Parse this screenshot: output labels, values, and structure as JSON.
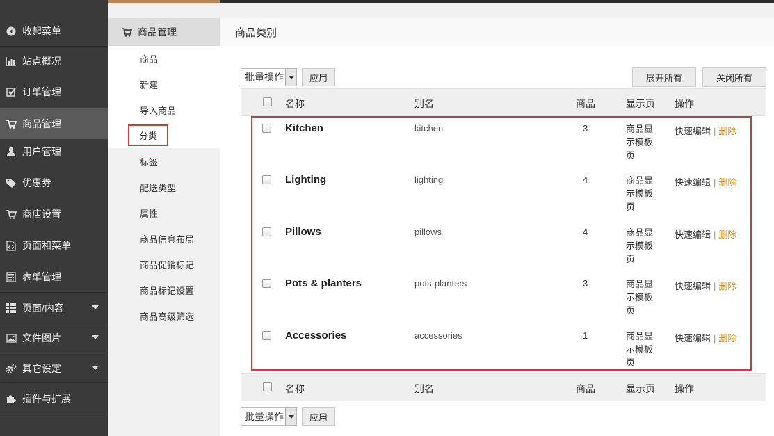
{
  "sidebar": {
    "items": [
      {
        "label": "收起菜单",
        "icon": "collapse-icon"
      },
      {
        "label": "站点概况",
        "icon": "bar-chart-icon"
      },
      {
        "label": "订单管理",
        "icon": "checkbox-icon"
      },
      {
        "label": "商品管理",
        "icon": "cart-icon"
      },
      {
        "label": "用户管理",
        "icon": "user-icon"
      },
      {
        "label": "优惠券",
        "icon": "tag-icon"
      },
      {
        "label": "商店设置",
        "icon": "cart-icon"
      },
      {
        "label": "页面和菜单",
        "icon": "code-file-icon"
      },
      {
        "label": "表单管理",
        "icon": "calculator-icon"
      },
      {
        "label": "页面/内容",
        "icon": "grid-icon"
      },
      {
        "label": "文件图片",
        "icon": "image-icon"
      },
      {
        "label": "其它设定",
        "icon": "gears-icon"
      },
      {
        "label": "插件与扩展",
        "icon": "puzzle-icon"
      }
    ]
  },
  "submenu": {
    "title": "商品管理",
    "items": [
      "商品",
      "新建",
      "导入商品",
      "分类",
      "标签",
      "配送类型",
      "属性",
      "商品信息布局",
      "商品促销标记",
      "商品标记设置",
      "商品高级筛选"
    ]
  },
  "page": {
    "title": "商品类别",
    "bulk_select": "批量操作",
    "apply": "应用",
    "expand_all": "展开所有",
    "close_all": "关闭所有"
  },
  "table": {
    "headers": {
      "name": "名称",
      "slug": "别名",
      "count": "商品",
      "display": "显示页",
      "actions": "操作"
    },
    "rows": [
      {
        "name": "Kitchen",
        "slug": "kitchen",
        "count": "3",
        "display": "商品显示模板页",
        "quick_edit": "快速编辑",
        "sep": "|",
        "delete": "删除"
      },
      {
        "name": "Lighting",
        "slug": "lighting",
        "count": "4",
        "display": "商品显示模板页",
        "quick_edit": "快速编辑",
        "sep": "|",
        "delete": "删除"
      },
      {
        "name": "Pillows",
        "slug": "pillows",
        "count": "4",
        "display": "商品显示模板页",
        "quick_edit": "快速编辑",
        "sep": "|",
        "delete": "删除"
      },
      {
        "name": "Pots & planters",
        "slug": "pots-planters",
        "count": "3",
        "display": "商品显示模板页",
        "quick_edit": "快速编辑",
        "sep": "|",
        "delete": "删除"
      },
      {
        "name": "Accessories",
        "slug": "accessories",
        "count": "1",
        "display": "商品显示模板页",
        "quick_edit": "快速编辑",
        "sep": "|",
        "delete": "删除"
      }
    ]
  },
  "colors": {
    "accent": "#b7865a",
    "delete_link": "#d8901b",
    "highlight_box": "#e0323a"
  }
}
